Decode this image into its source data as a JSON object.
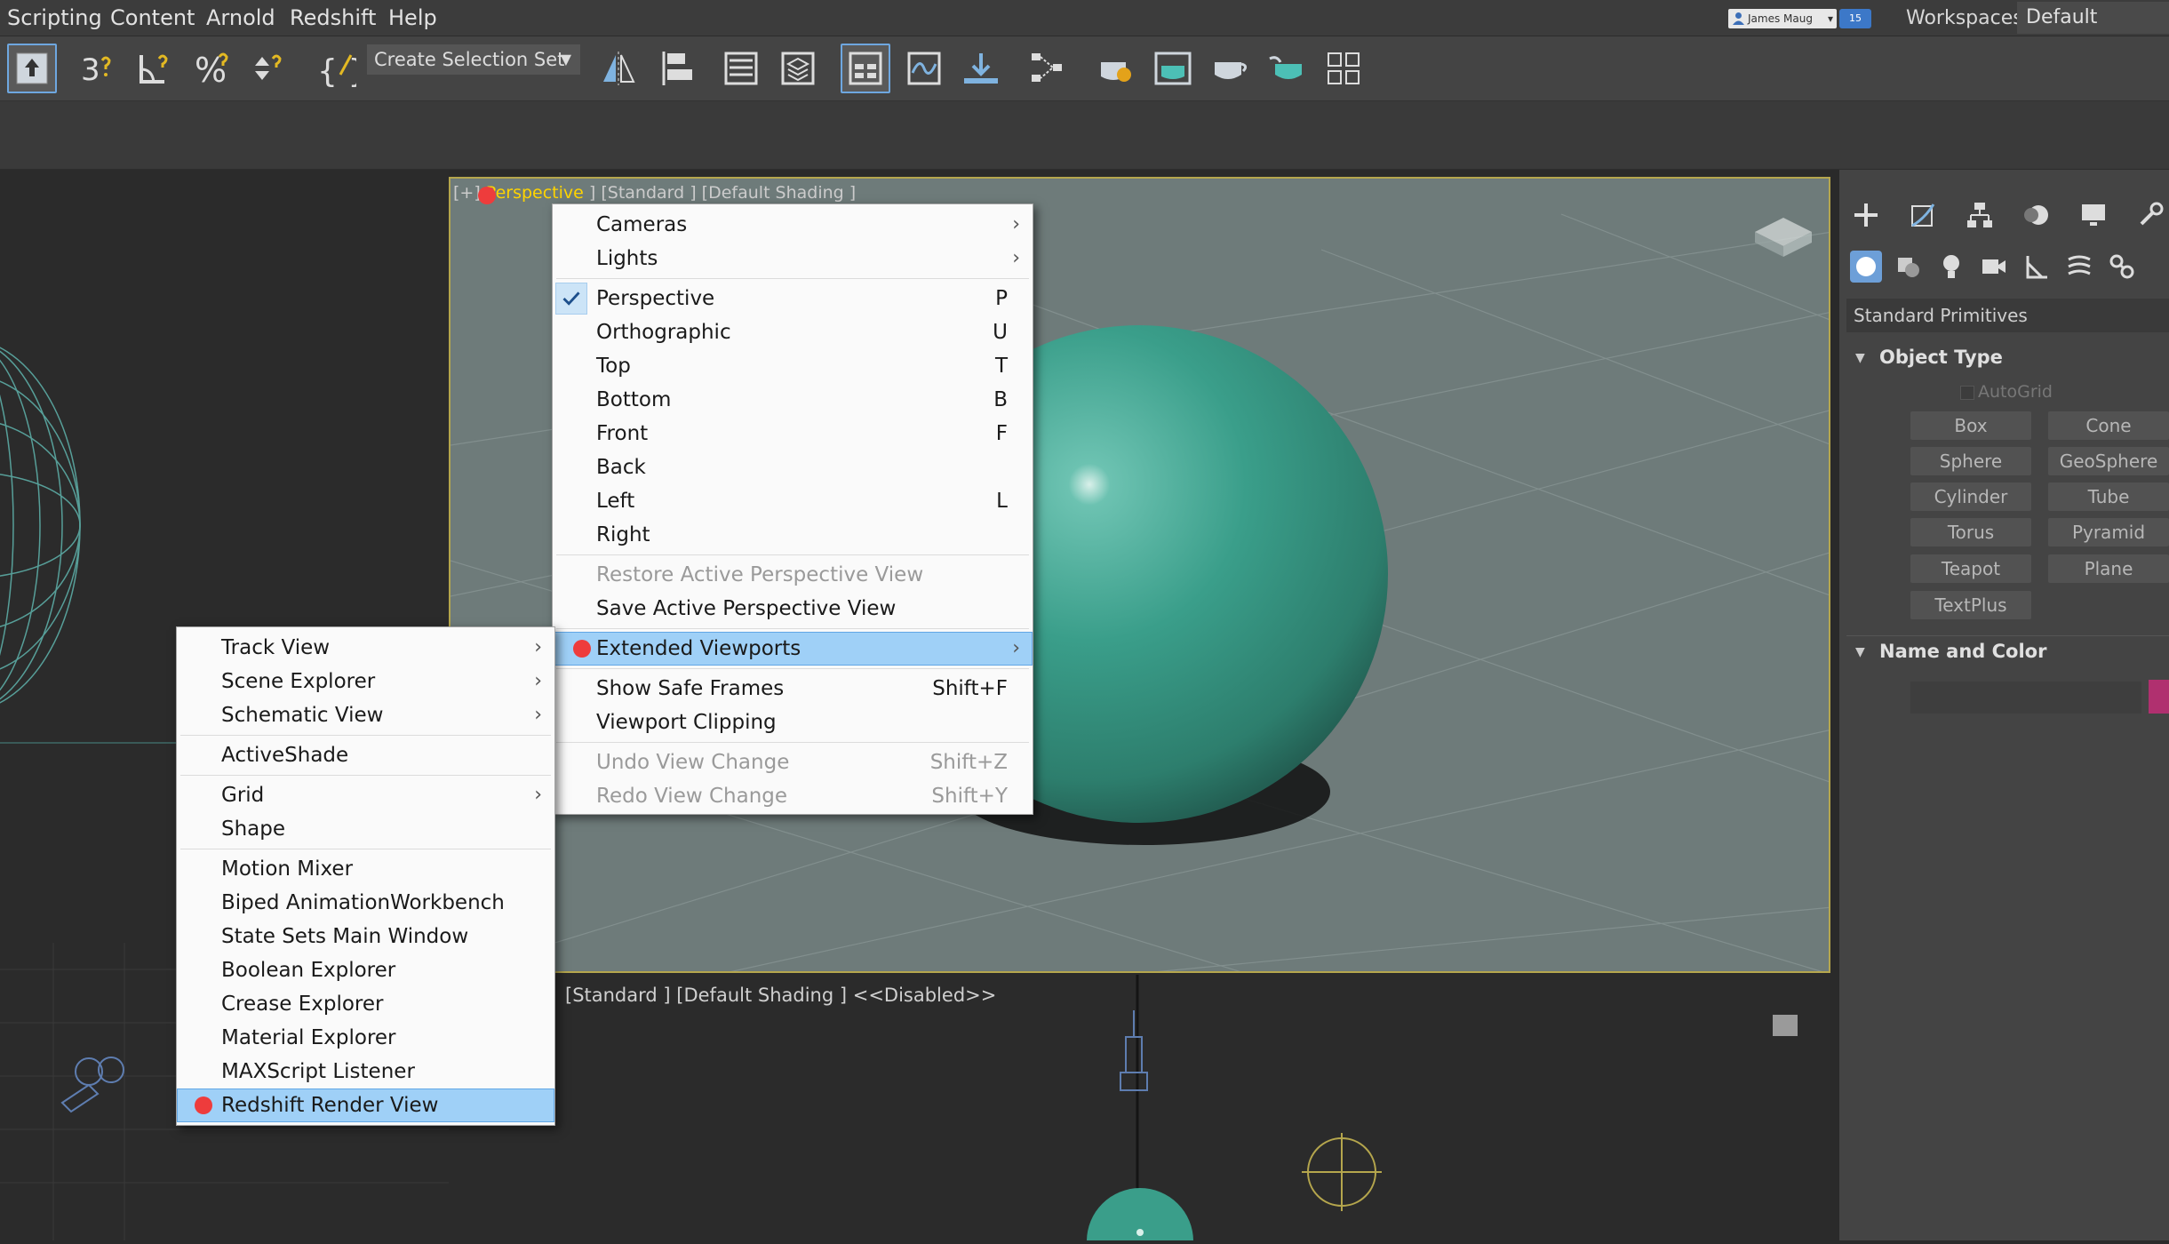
{
  "menubar": {
    "items": [
      "Scripting",
      "Content",
      "Arnold",
      "Redshift",
      "Help"
    ],
    "user": "James Maug",
    "badge": "15",
    "workspaces_label": "Workspaces:",
    "workspace_value": "Default"
  },
  "toolbar": {
    "selection_set_placeholder": "Create Selection Set",
    "icons": [
      "select-link-icon",
      "snap-3d-icon",
      "angle-snap-icon",
      "percent-snap-icon",
      "spinner-snap-icon",
      "edit-named-selection-icon",
      "mirror-icon",
      "align-icon",
      "scene-explorer-icon",
      "layer-explorer-icon",
      "toggle-ribbon-icon",
      "curve-editor-icon",
      "dope-sheet-icon",
      "schematic-view-icon",
      "render-setup-icon",
      "rendered-frame-window-icon",
      "render-icon",
      "render-iterative-icon",
      "extras-grid-icon"
    ]
  },
  "viewport": {
    "persp_prefix": "[+]",
    "persp_name": "Perspective",
    "persp_rest": "] [Standard ] [Default Shading ]",
    "bottom_label": "[Standard ] [Default Shading ]  <<Disabled>>"
  },
  "main_menu": {
    "items": [
      {
        "label": "Cameras",
        "submenu": true
      },
      {
        "label": "Lights",
        "submenu": true
      },
      {
        "label": "Perspective",
        "shortcut": "P",
        "checked": true
      },
      {
        "label": "Orthographic",
        "shortcut": "U"
      },
      {
        "label": "Top",
        "shortcut": "T"
      },
      {
        "label": "Bottom",
        "shortcut": "B"
      },
      {
        "label": "Front",
        "shortcut": "F"
      },
      {
        "label": "Back",
        "shortcut": ""
      },
      {
        "label": "Left",
        "shortcut": "L"
      },
      {
        "label": "Right",
        "shortcut": ""
      },
      {
        "label": "Restore Active Perspective View",
        "disabled": true
      },
      {
        "label": "Save Active Perspective View"
      },
      {
        "label": "Extended Viewports",
        "submenu": true,
        "highlighted": true
      },
      {
        "label": "Show Safe Frames",
        "shortcut": "Shift+F"
      },
      {
        "label": "Viewport Clipping"
      },
      {
        "label": "Undo View Change",
        "shortcut": "Shift+Z",
        "disabled": true
      },
      {
        "label": "Redo View Change",
        "shortcut": "Shift+Y",
        "disabled": true
      }
    ]
  },
  "ext_menu": {
    "items": [
      {
        "label": "Track View",
        "submenu": true
      },
      {
        "label": "Scene Explorer",
        "submenu": true
      },
      {
        "label": "Schematic View",
        "submenu": true
      },
      {
        "label": "ActiveShade"
      },
      {
        "label": "Grid",
        "submenu": true
      },
      {
        "label": "Shape"
      },
      {
        "label": "Motion Mixer"
      },
      {
        "label": "Biped AnimationWorkbench"
      },
      {
        "label": "State Sets Main Window"
      },
      {
        "label": "Boolean Explorer"
      },
      {
        "label": "Crease Explorer"
      },
      {
        "label": "Material Explorer"
      },
      {
        "label": "MAXScript Listener"
      },
      {
        "label": "Redshift Render View",
        "highlighted": true
      }
    ]
  },
  "command_panel": {
    "dropdown": "Standard Primitives",
    "object_type_title": "Object Type",
    "autogrid": "AutoGrid",
    "primitives": [
      "Box",
      "Cone",
      "Sphere",
      "GeoSphere",
      "Cylinder",
      "Tube",
      "Torus",
      "Pyramid",
      "Teapot",
      "Plane",
      "TextPlus"
    ],
    "name_color_title": "Name and Color",
    "swatch_color": "#b0306f"
  },
  "colors": {
    "highlight": "#9fd0f7",
    "redshift_dot": "#ee3c3c",
    "sphere": "#3a9e8a",
    "viewport_border": "#b5a64d"
  }
}
